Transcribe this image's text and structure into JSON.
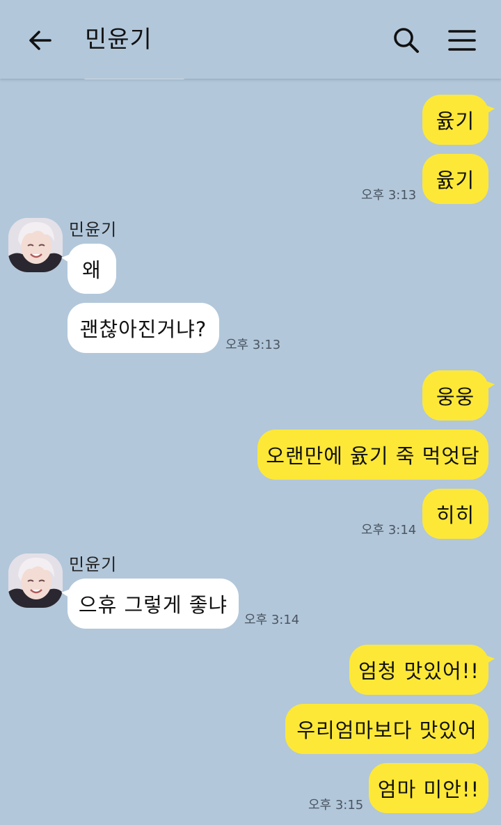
{
  "header": {
    "title": "민윤기",
    "back_icon": "arrow-left-icon",
    "search_icon": "search-icon",
    "menu_icon": "hamburger-menu-icon"
  },
  "colors": {
    "background": "#b2c7da",
    "my_bubble": "#fde837",
    "their_bubble": "#ffffff"
  },
  "messages": {
    "m1": "윬기",
    "m2": "윬기",
    "t1": "오후 3:13",
    "sender1": "민윤기",
    "m3": "왜",
    "m4": "괜찮아진거냐?",
    "t2": "오후 3:13",
    "m5": "웅웅",
    "m6": "오랜만에 윬기 죽 먹엇담",
    "m7": "히히",
    "t3": "오후 3:14",
    "sender2": "민윤기",
    "m8": "으휴 그렇게 좋냐",
    "t4": "오후 3:14",
    "m9": "엄청 맛있어!!",
    "m10": "우리엄마보다 맛있어",
    "m11": "엄마 미안!!",
    "t5": "오후 3:15"
  }
}
